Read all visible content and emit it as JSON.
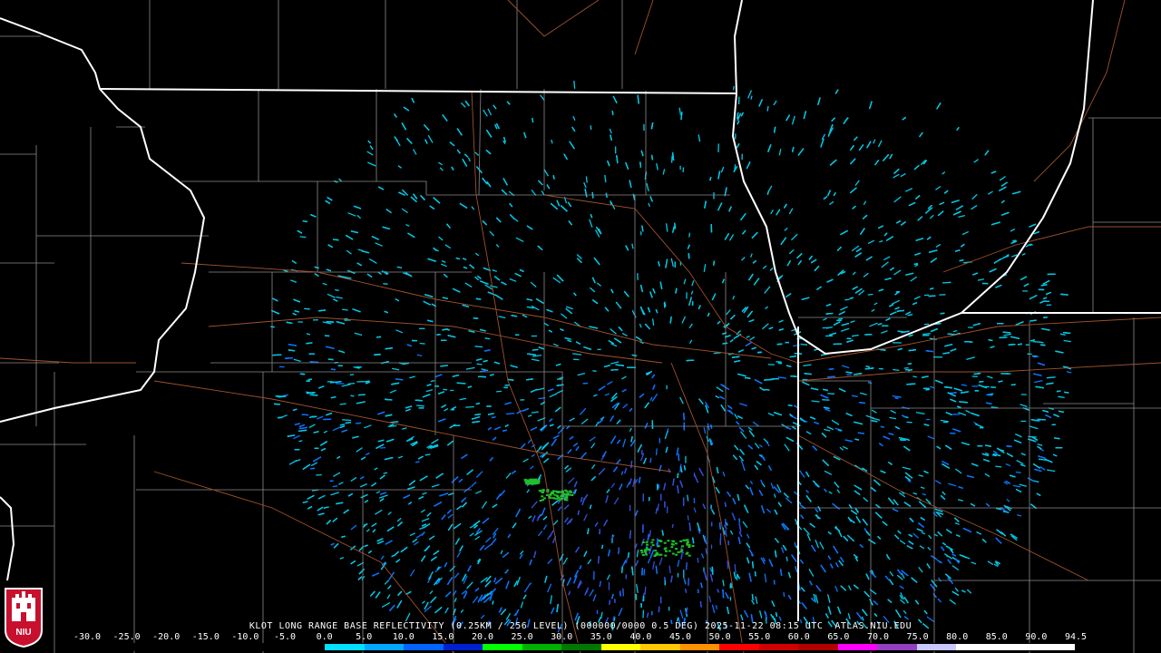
{
  "radar": {
    "header": "KLOT LONG RANGE BASE REFLECTIVITY (0.25KM / 256 LEVEL) (000000/0000 0.5 DEG) 2025-11-22 08:15 UTC  ATLAS.NIU.EDU",
    "station": "KLOT",
    "product": "LONG RANGE BASE REFLECTIVITY",
    "timestamp": "2025-11-22 08:15 UTC",
    "source": "ATLAS.NIU.EDU",
    "logo_text": "NIU"
  },
  "scale": {
    "labels": [
      "-30.0",
      "-25.0",
      "-20.0",
      "-15.0",
      "-10.0",
      "-5.0",
      "0.0",
      "5.0",
      "10.0",
      "15.0",
      "20.0",
      "25.0",
      "30.0",
      "35.0",
      "40.0",
      "45.0",
      "50.0",
      "55.0",
      "60.0",
      "65.0",
      "70.0",
      "75.0",
      "80.0",
      "85.0",
      "90.0",
      "94.5"
    ],
    "colors": [
      "#000000",
      "#000000",
      "#000000",
      "#000000",
      "#000000",
      "#000000",
      "#00e0ff",
      "#00a8ff",
      "#0064ff",
      "#0020d0",
      "#00ff00",
      "#00b000",
      "#007800",
      "#ffff00",
      "#ffc800",
      "#ff9000",
      "#ff0000",
      "#d00000",
      "#b00000",
      "#ff00ff",
      "#9040c0",
      "#c8c8ff",
      "#ffffff",
      "#ffffff",
      "#ffffff"
    ]
  },
  "colors": {
    "state_border": "#ffffff",
    "county_border": "#8a8a8a",
    "highway": "#a0522d",
    "echo_light": "#00c8e6",
    "echo_medium": "#0a74ff",
    "echo_heavy": "#2f4fd8",
    "echo_green": "#1fbf2a",
    "background": "#000000"
  }
}
